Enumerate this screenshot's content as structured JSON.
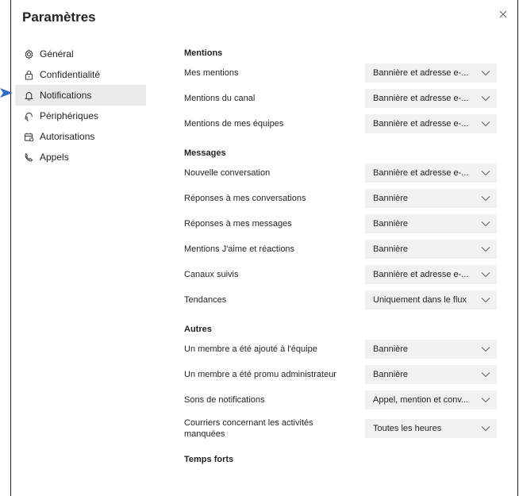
{
  "dialog": {
    "title": "Paramètres"
  },
  "sidebar": {
    "items": [
      {
        "label": "Général",
        "icon": "gear-icon"
      },
      {
        "label": "Confidentialité",
        "icon": "lock-icon"
      },
      {
        "label": "Notifications",
        "icon": "bell-icon",
        "active": true
      },
      {
        "label": "Périphériques",
        "icon": "headset-icon"
      },
      {
        "label": "Autorisations",
        "icon": "permissions-icon"
      },
      {
        "label": "Appels",
        "icon": "phone-icon"
      }
    ]
  },
  "sections": [
    {
      "title": "Mentions",
      "rows": [
        {
          "label": "Mes mentions",
          "value": "Bannière et adresse e-..."
        },
        {
          "label": "Mentions du canal",
          "value": "Bannière et adresse e-..."
        },
        {
          "label": "Mentions de mes équipes",
          "value": "Bannière et adresse e-..."
        }
      ]
    },
    {
      "title": "Messages",
      "rows": [
        {
          "label": "Nouvelle conversation",
          "value": "Bannière et adresse e-..."
        },
        {
          "label": "Réponses à mes conversations",
          "value": "Bannière"
        },
        {
          "label": "Réponses à mes messages",
          "value": "Bannière"
        },
        {
          "label": "Mentions J'aime et réactions",
          "value": "Bannière"
        },
        {
          "label": "Canaux suivis",
          "value": "Bannière et adresse e-..."
        },
        {
          "label": "Tendances",
          "value": "Uniquement dans le flux"
        }
      ]
    },
    {
      "title": "Autres",
      "rows": [
        {
          "label": "Un membre a été ajouté à l'équipe",
          "value": "Bannière"
        },
        {
          "label": "Un membre a été promu administrateur",
          "value": "Bannière"
        },
        {
          "label": "Sons de notifications",
          "value": "Appel, mention et conv..."
        },
        {
          "label": "Courriers concernant les activités manquées",
          "value": "Toutes les heures"
        }
      ]
    },
    {
      "title": "Temps forts",
      "rows": []
    }
  ],
  "colors": {
    "pointer": "#2f6cc6",
    "active_bg": "#ebebeb",
    "select_bg": "#f1f1f1"
  }
}
